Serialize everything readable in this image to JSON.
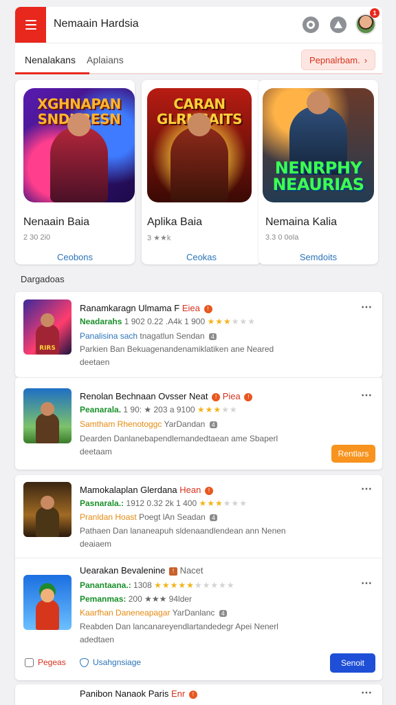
{
  "header": {
    "title": "Nemaain Hardsia",
    "notification_count": "1"
  },
  "tabs": {
    "tab1": "Nenalakans",
    "tab2": "Aplaians",
    "promo_label": "Pepnalrbam.",
    "promo_chevron": "›"
  },
  "featured": [
    {
      "logo": "XGHNAPAN SNDHRESN",
      "title": "Nenaain Baia",
      "meta": "2 30 2i0",
      "link": "Ceobons"
    },
    {
      "logo": "CARAN GLRNGAITS",
      "title": "Aplika Baia",
      "meta": "3 ★★k",
      "link": "Ceokas"
    },
    {
      "logo": "NENRPHY NEAURIAS",
      "title": "Nemaina Kalia",
      "meta": "3.3 0 0ola",
      "link": "Semdoits"
    }
  ],
  "section_label": "Dargadoas",
  "list": [
    {
      "title": "Ranamkaragn Ulmama F",
      "tag": "Eiea",
      "line1_green": "Neadarahs",
      "line1_text": "1 902 0.22 .A4k 1 900",
      "line1_stars": "★★★",
      "line1_stars_off": "★★★",
      "line2_blue": "Panalisina sach",
      "line2_text": "tnagatlun Sendan",
      "line2_badge": "4",
      "desc": "Parkien Ban Bekuagenandenamiklatiken ane Neared deetaen",
      "badge": "RIRS"
    },
    {
      "title": "Renolan Bechnaan Ovsser Neat",
      "tag": "Piea",
      "line1_green": "Peanarala.",
      "line1_text": "1 90: ★ 203 a 9100",
      "line1_stars": "★★★",
      "line1_stars_off": "★★",
      "line2_orange": "Samtham Rhenotoggc",
      "line2_text": "YarDandan",
      "line2_badge": "4",
      "desc": "Dearden Danlanebapendlemandedtaean ame Sbaperl deetaam",
      "button": "Rentlars"
    },
    {
      "title": "Mamokalaplan Glerdana",
      "tag": "Hean",
      "line1_green": "Pasnarala.:",
      "line1_text": "1912 0.32 2k 1 400",
      "line1_stars": "★★★",
      "line1_stars_off": "★★★",
      "line2_orange": "Pranldan Hoast",
      "line2_text": "Poegt lAn Seadan",
      "line2_badge": "4",
      "desc": "Pathaen Dan lananeapuh sldenaandlendean ann Nenen deaiaem"
    },
    {
      "title": "Uearakan Bevalenine",
      "tag": "Nacet",
      "line1_green": "Panantaana.:",
      "line1_text": "1308",
      "line1_stars": "★★★★★",
      "line1_stars_off": "★★★★★",
      "line2_green": "Pemanmas:",
      "line2_text": "200 ★★★ 94lder",
      "line3_orange": "Kaarfhan Daneneapagar",
      "line3_text": "YarDanlanc",
      "line3_badge": "4",
      "desc": "Reabden Dan lancanareyendlartandedegr Apei Nenerl adedtaen",
      "action1": "Pegeas",
      "action2": "Usahgnsiage",
      "button": "Senoit"
    }
  ],
  "last_item": {
    "title": "Panibon Nanaok Paris",
    "tag": "Enr"
  },
  "colors": {
    "accent": "#e8271d",
    "link": "#2a74b9",
    "green": "#1a8f2a",
    "orange": "#f7931e",
    "blue_button": "#1e4fd6"
  }
}
